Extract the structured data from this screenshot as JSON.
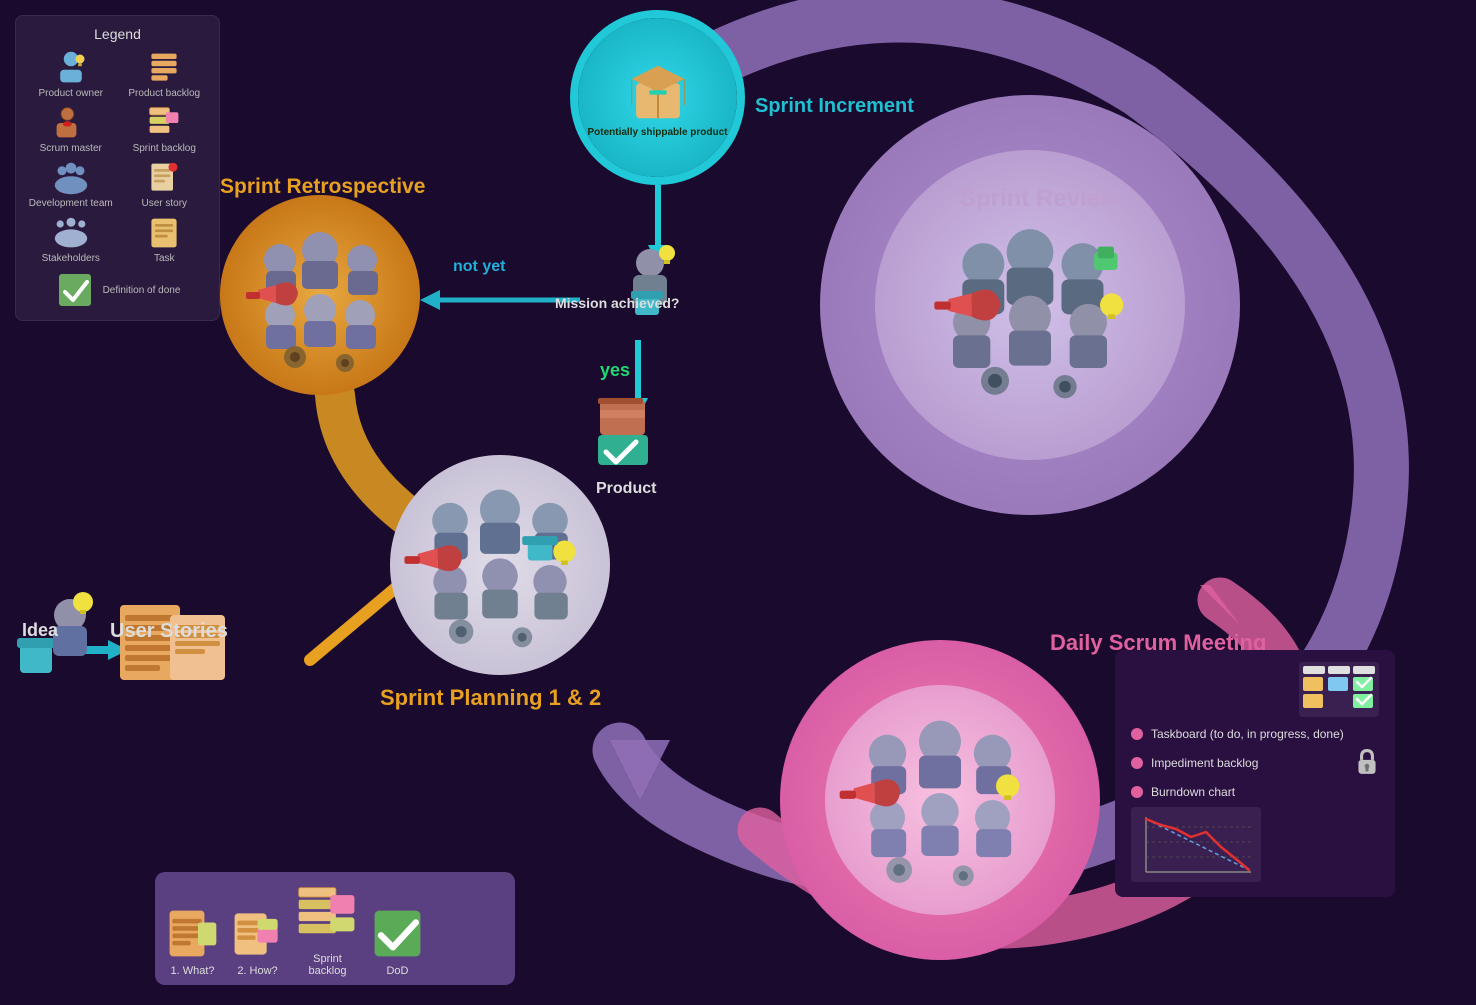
{
  "legend": {
    "title": "Legend",
    "items": [
      {
        "label": "Product owner",
        "icon": "person-icon"
      },
      {
        "label": "Product backlog",
        "icon": "list-icon"
      },
      {
        "label": "Scrum master",
        "icon": "person-hat-icon"
      },
      {
        "label": "Sprint backlog",
        "icon": "list2-icon"
      },
      {
        "label": "Development team",
        "icon": "team-icon"
      },
      {
        "label": "User story",
        "icon": "sticky-icon"
      },
      {
        "label": "Stakeholders",
        "icon": "group-icon"
      },
      {
        "label": "Task",
        "icon": "task-icon"
      },
      {
        "label": "",
        "icon": ""
      },
      {
        "label": "Definition of done",
        "icon": "check-icon"
      }
    ]
  },
  "labels": {
    "sprint_retrospective": "Sprint Retrospective",
    "sprint_increment": "Sprint Increment",
    "sprint_review": "Sprint Review",
    "mission_achieved": "Mission achieved?",
    "not_yet": "not yet",
    "yes": "yes",
    "product": "Product",
    "idea": "Idea",
    "user_stories": "User Stories",
    "sprint_planning": "Sprint Planning 1 & 2",
    "daily_scrum": "Daily Scrum Meeting",
    "potentially_shippable": "Potentially shippable product"
  },
  "planning_items": [
    {
      "label": "1. What?",
      "icon": "backlog-icon"
    },
    {
      "label": "2. How?",
      "icon": "howto-icon"
    },
    {
      "label": "Sprint backlog",
      "icon": "sprintbacklog-icon"
    },
    {
      "label": "DoD",
      "icon": "dod-icon"
    }
  ],
  "daily_legend": {
    "items": [
      {
        "label": "Taskboard (to do, in progress, done)",
        "color": "#e060a0"
      },
      {
        "label": "Impediment backlog",
        "color": "#e060a0"
      },
      {
        "label": "Burndown chart",
        "color": "#e060a0"
      }
    ]
  },
  "colors": {
    "background": "#1a0a2e",
    "teal": "#20c8d8",
    "orange": "#e8a020",
    "purple_light": "#c0a0d0",
    "pink": "#e060a0",
    "green": "#20d870",
    "blue_arrow": "#20b0c8"
  }
}
